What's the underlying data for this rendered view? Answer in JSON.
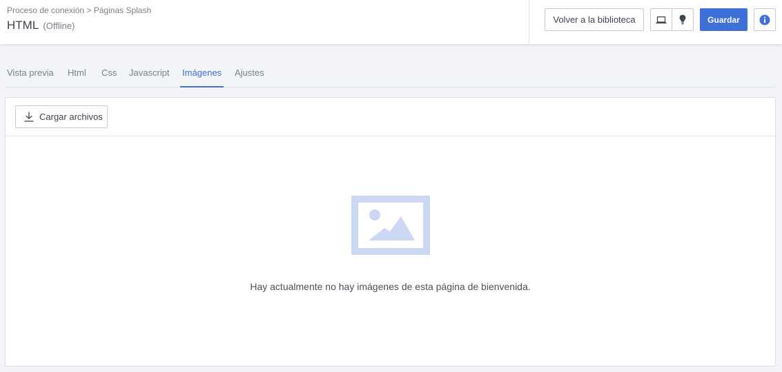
{
  "header": {
    "breadcrumb": "Proceso de conexión > Páginas Splash",
    "title": "HTML",
    "status": "(Offline)",
    "back_button": "Volver a la biblioteca",
    "save_button": "Guardar"
  },
  "tabs": [
    {
      "label": "Vista previa",
      "active": false
    },
    {
      "label": "Html",
      "active": false
    },
    {
      "label": "Css",
      "active": false
    },
    {
      "label": "Javascript",
      "active": false
    },
    {
      "label": "Imágenes",
      "active": true
    },
    {
      "label": "Ajustes",
      "active": false
    }
  ],
  "panel": {
    "upload_button": "Cargar archivos",
    "empty_message": "Hay actualmente no hay imágenes de esta página de bienvenida."
  },
  "icons": {
    "preview_device": "laptop-icon",
    "tip": "lightbulb-icon",
    "info": "info-circle-icon",
    "upload": "download-arrow-icon",
    "empty_state": "image-placeholder-icon"
  },
  "colors": {
    "accent": "#3f6fd8",
    "placeholder": "#ccd7f3",
    "background": "#f3f4f8"
  }
}
